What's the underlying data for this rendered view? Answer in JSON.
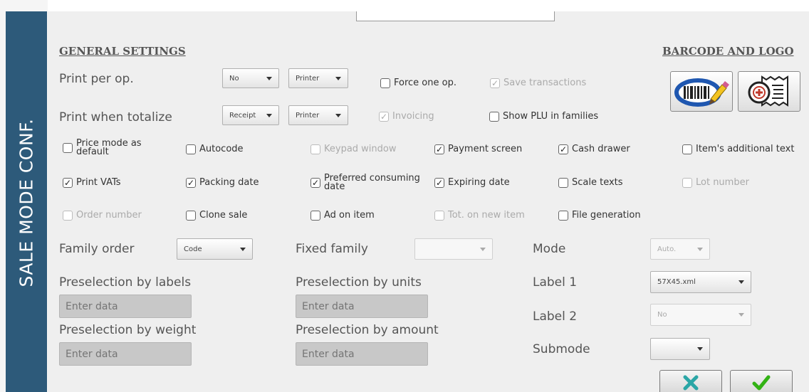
{
  "sidebar": {
    "title": "SALE MODE CONF."
  },
  "general": {
    "title": "GENERAL SETTINGS",
    "print_per_op": {
      "label": "Print per op.",
      "dd1": "No",
      "dd2": "Printer"
    },
    "print_when_totalize": {
      "label": "Print when totalize",
      "dd1": "Receipt",
      "dd2": "Printer"
    },
    "force_one_op": "Force one op.",
    "save_transactions": "Save transactions",
    "invoicing": "Invoicing",
    "show_plu": "Show PLU in families"
  },
  "barcode": {
    "title": "BARCODE AND LOGO"
  },
  "checks": {
    "price_mode_1": "Price mode as",
    "price_mode_2": "default",
    "autocode": "Autocode",
    "keypad_window": "Keypad window",
    "payment_screen": "Payment screen",
    "cash_drawer": "Cash drawer",
    "items_additional_text": "Item's additional text",
    "print_vats": "Print VATs",
    "packing_date": "Packing date",
    "preferred_1": "Preferred consuming",
    "preferred_2": "date",
    "expiring_date": "Expiring date",
    "scale_texts": "Scale texts",
    "lot_number": "Lot number",
    "order_number": "Order number",
    "clone_sale": "Clone sale",
    "ad_on_item": "Ad on item",
    "tot_new_item": "Tot. on new item",
    "file_generation": "File generation"
  },
  "family": {
    "order_label": "Family order",
    "order_value": "Code",
    "fixed_label": "Fixed family",
    "fixed_value": ""
  },
  "preselection": {
    "labels": "Preselection by labels",
    "units": "Preselection by units",
    "weight": "Preselection by weight",
    "amount": "Preselection by amount",
    "placeholder": "Enter data"
  },
  "right": {
    "mode_label": "Mode",
    "mode_value": "Auto.",
    "label1_label": "Label 1",
    "label1_value": "57X45.xml",
    "label2_label": "Label 2",
    "label2_value": "No",
    "submode_label": "Submode",
    "submode_value": ""
  },
  "icons": {
    "cancel": "x-icon",
    "confirm": "check-icon",
    "barcode": "barcode-icon",
    "logo": "receipt-icon"
  },
  "colors": {
    "sidebar": "#2d5a7a",
    "cancel": "#2aa6a6",
    "confirm": "#32b214"
  }
}
